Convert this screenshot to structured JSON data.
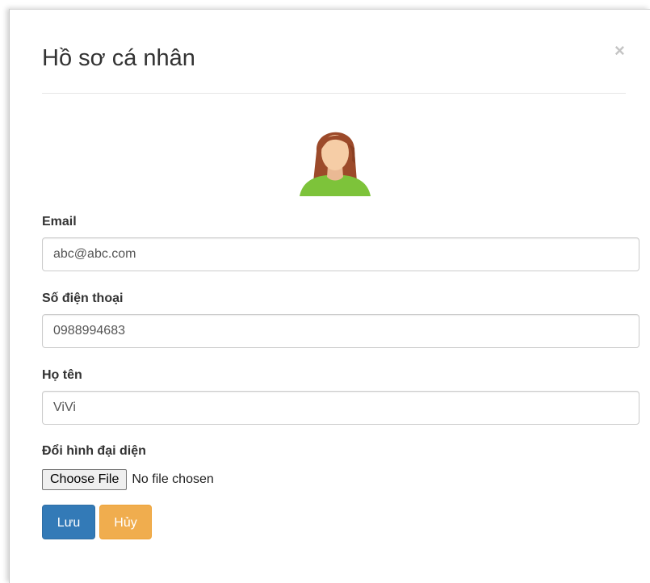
{
  "modal": {
    "title": "Hồ sơ cá nhân",
    "close_label": "×"
  },
  "avatar": {
    "icon": "female-user-avatar-icon",
    "colors": {
      "hair": "#9c4a2a",
      "skin": "#f6cda6",
      "shirt": "#7dc33a"
    }
  },
  "form": {
    "email": {
      "label": "Email",
      "value": "abc@abc.com"
    },
    "phone": {
      "label": "Số điện thoại",
      "value": "0988994683"
    },
    "fullname": {
      "label": "Họ tên",
      "value": "ViVi"
    },
    "avatar_upload": {
      "label": "Đổi hình đại diện",
      "button_label": "Choose File",
      "status": "No file chosen"
    }
  },
  "actions": {
    "save_label": "Lưu",
    "cancel_label": "Hủy",
    "colors": {
      "save": "#337ab7",
      "cancel": "#f0ad4e"
    }
  }
}
